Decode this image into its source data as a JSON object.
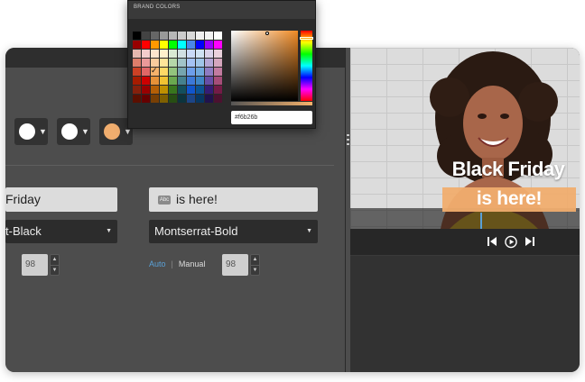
{
  "picker": {
    "title": "BRAND COLORS",
    "hex_value": "#f6b26b",
    "palette": [
      "#000000",
      "#434343",
      "#666666",
      "#999999",
      "#b7b7b7",
      "#cccccc",
      "#d9d9d9",
      "#efefef",
      "#f3f3f3",
      "#ffffff",
      "#980000",
      "#ff0000",
      "#ff9900",
      "#ffff00",
      "#00ff00",
      "#00ffff",
      "#4a86e8",
      "#0000ff",
      "#9900ff",
      "#ff00ff",
      "#e6b8af",
      "#f4cccc",
      "#fce5cd",
      "#fff2cc",
      "#d9ead3",
      "#d0e0e3",
      "#c9daf8",
      "#cfe2f3",
      "#d9d2e9",
      "#ead1dc",
      "#dd7e6b",
      "#ea9999",
      "#f9cb9c",
      "#ffe599",
      "#b6d7a8",
      "#a2c4c9",
      "#a4c2f4",
      "#9fc5e8",
      "#b4a7d6",
      "#d5a6bd",
      "#cc4125",
      "#e06666",
      "#f6b26b",
      "#ffd966",
      "#93c47d",
      "#76a5af",
      "#6d9eeb",
      "#6fa8dc",
      "#8e7cc3",
      "#c27ba0",
      "#a61c00",
      "#cc0000",
      "#e69138",
      "#f1c232",
      "#6aa84f",
      "#45818e",
      "#3c78d8",
      "#3d85c6",
      "#674ea7",
      "#a64d79",
      "#85200c",
      "#990000",
      "#b45f06",
      "#bf9000",
      "#38761d",
      "#134f5c",
      "#1155cc",
      "#0b5394",
      "#351c75",
      "#741b47",
      "#5b0f00",
      "#660000",
      "#783f04",
      "#7f6000",
      "#274e13",
      "#0c343d",
      "#1c4587",
      "#073763",
      "#20124d",
      "#4c1130"
    ],
    "selected_index": 42
  },
  "swatches": [
    {
      "color": "#ffffff",
      "caret": "▼"
    },
    {
      "color": "#ffffff",
      "caret": "▼"
    },
    {
      "color": "#f0ad6e",
      "caret": "▼"
    }
  ],
  "left_col": {
    "text_value": "Friday",
    "font_value": "t-Black",
    "size_value": "98"
  },
  "right_col": {
    "text_value": "is here!",
    "font_value": "Montserrat-Bold",
    "size_value": "98",
    "mode_auto": "Auto",
    "mode_sep": "|",
    "mode_manual": "Manual"
  },
  "preview": {
    "line1": "Black Friday",
    "line2": "is here!"
  },
  "colors": {
    "accent": "#5aa0d6",
    "highlight": "#f0ad6e"
  }
}
